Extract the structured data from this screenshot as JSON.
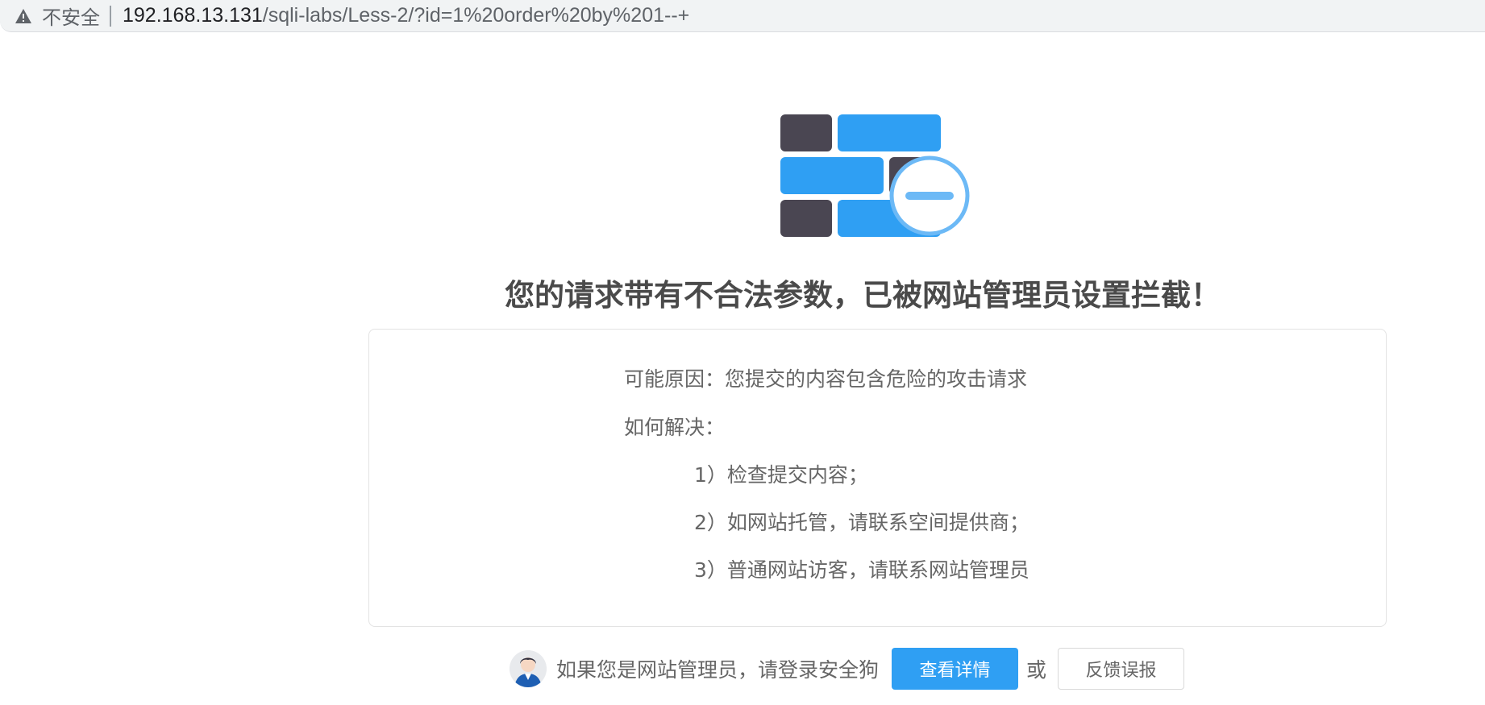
{
  "browser": {
    "security_label": "不安全",
    "url_host": "192.168.13.131",
    "url_path": "/sqli-labs/Less-2/?id=1%20order%20by%201--+",
    "warning_icon": "warning-triangle-icon"
  },
  "main": {
    "logo_icon": "firewall-block-icon",
    "title": "您的请求带有不合法参数，已被网站管理员设置拦截！",
    "reason": "可能原因：您提交的内容包含危险的攻击请求",
    "solve_heading": "如何解决：",
    "steps": [
      "1）检查提交内容；",
      "2）如网站托管，请联系空间提供商；",
      "3）普通网站访客，请联系网站管理员"
    ]
  },
  "footer": {
    "admin_prompt": "如果您是网站管理员，请登录安全狗",
    "details_button": "查看详情",
    "or_text": "或",
    "feedback_button": "反馈误报",
    "avatar_icon": "admin-avatar-icon"
  },
  "colors": {
    "accent_blue": "#2f9ff3",
    "brick_dark": "#4a4652",
    "title_gray": "#4a4a4a",
    "text_gray": "#666666"
  }
}
